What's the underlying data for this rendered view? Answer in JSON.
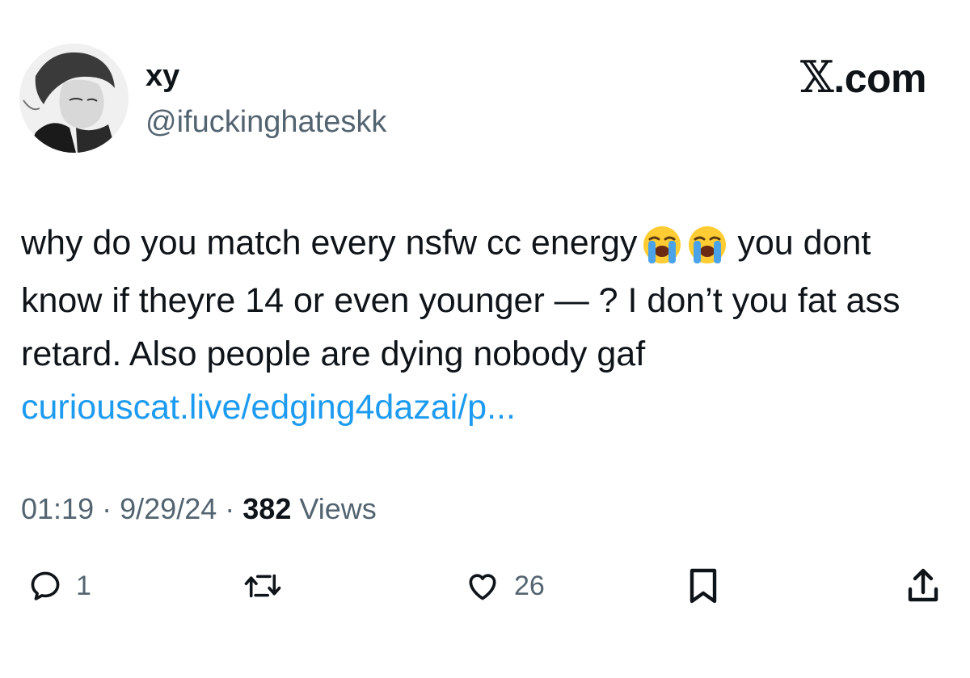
{
  "user": {
    "display_name": "xy",
    "handle": "@ifuckinghateskk"
  },
  "brand": {
    "x_glyph": "𝕏",
    "suffix": ".com"
  },
  "tweet": {
    "text_before_emoji": "why do you match every nsfw cc energy",
    "emoji": [
      "loudly-crying-face",
      "loudly-crying-face"
    ],
    "text_after_emoji": "you dont know if theyre 14 or even younger — ? I don’t you fat ass retard. Also people are dying nobody gaf",
    "link": "curiouscat.live/edging4dazai/p..."
  },
  "meta": {
    "time": "01:19",
    "separator": "·",
    "date": "9/29/24",
    "views_count": "382",
    "views_label": "Views"
  },
  "actions": {
    "reply_count": "1",
    "retweet_count": "",
    "like_count": "26"
  },
  "colors": {
    "text": "#0f1419",
    "secondary": "#536471",
    "link": "#1d9bf0"
  },
  "icons": [
    "reply-icon",
    "retweet-icon",
    "like-icon",
    "bookmark-icon",
    "share-icon"
  ]
}
